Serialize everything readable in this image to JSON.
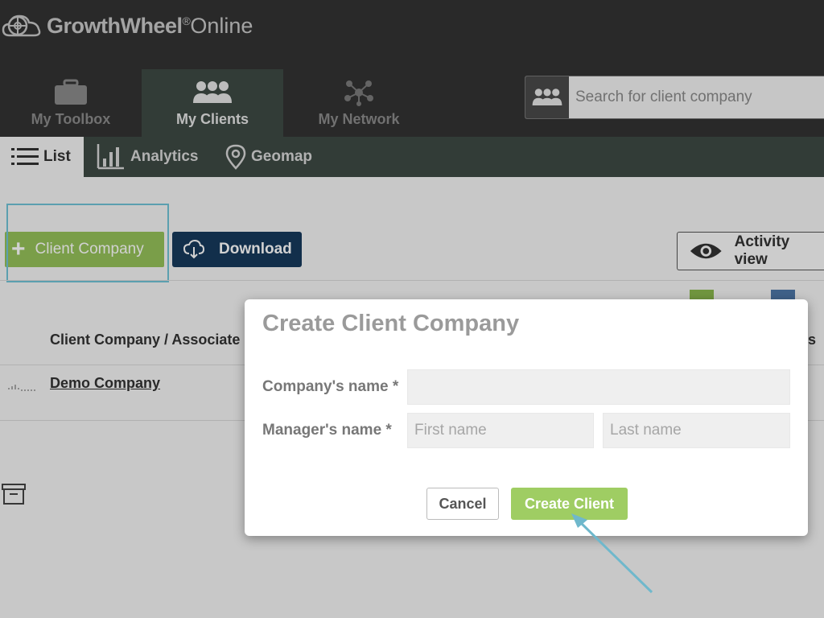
{
  "app": {
    "brand": "GrowthWheel",
    "brand_reg": "®",
    "brand_suffix": "Online"
  },
  "nav": {
    "tabs": [
      {
        "label": "My Toolbox",
        "icon": "toolbox-icon"
      },
      {
        "label": "My Clients",
        "icon": "people-icon",
        "active": true
      },
      {
        "label": "My Network",
        "icon": "network-icon"
      }
    ],
    "search_placeholder": "Search for client company"
  },
  "subnav": {
    "tabs": [
      {
        "label": "List",
        "icon": "list-icon",
        "active": true
      },
      {
        "label": "Analytics",
        "icon": "bar-chart-icon"
      },
      {
        "label": "Geomap",
        "icon": "map-pin-icon"
      }
    ]
  },
  "toolbar": {
    "add_label": "Client Company",
    "download_label": "Download",
    "activity_label": "Activity view"
  },
  "table": {
    "column_header": "Client Company / Associate",
    "column_header_right": "s",
    "rows": [
      {
        "name": "Demo Company"
      }
    ]
  },
  "modal": {
    "title": "Create Client Company",
    "company_label": "Company's name *",
    "company_value": "",
    "manager_label": "Manager's name *",
    "first_name_placeholder": "First name",
    "last_name_placeholder": "Last name",
    "cancel_label": "Cancel",
    "create_label": "Create Client"
  },
  "colors": {
    "header_bg": "#323232",
    "subnav_bg": "#3d4a44",
    "accent_green": "#95c15a",
    "download_blue": "#163a5c",
    "highlight": "#6fc3d6"
  }
}
